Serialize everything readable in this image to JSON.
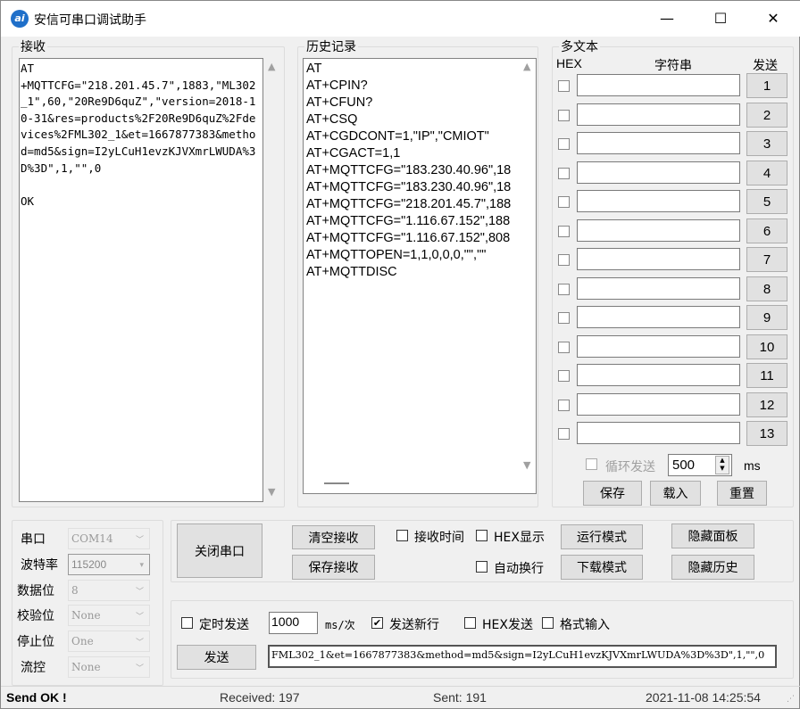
{
  "window": {
    "title": "安信可串口调试助手",
    "icon_text": "ai",
    "minimize": "—",
    "maximize": "☐",
    "close": "✕"
  },
  "receive": {
    "label": "接收",
    "text": "AT\n+MQTTCFG=\"218.201.45.7\",1883,\"ML302_1\",60,\"20Re9D6quZ\",\"version=2018-10-31&res=products%2F20Re9D6quZ%2Fdevices%2FML302_1&et=1667877383&method=md5&sign=I2yLCuH1evzKJVXmrLWUDA%3D%3D\",1,\"\",0\n\nOK"
  },
  "history": {
    "label": "历史记录",
    "items": [
      "AT",
      "AT+CPIN?",
      "AT+CFUN?",
      "AT+CSQ",
      "AT+CGDCONT=1,\"IP\",\"CMIOT\"",
      "AT+CGACT=1,1",
      "AT+MQTTCFG=\"183.230.40.96\",18",
      "AT+MQTTCFG=\"183.230.40.96\",18",
      "AT+MQTTCFG=\"218.201.45.7\",188",
      "AT+MQTTCFG=\"1.116.67.152\",188",
      "AT+MQTTCFG=\"1.116.67.152\",808",
      "AT+MQTTOPEN=1,1,0,0,0,\"\",\"\"",
      "AT+MQTTDISC"
    ]
  },
  "multi": {
    "label": "多文本",
    "hex_header": "HEX",
    "string_header": "字符串",
    "send_header": "发送",
    "rows": [
      "1",
      "2",
      "3",
      "4",
      "5",
      "6",
      "7",
      "8",
      "9",
      "10",
      "11",
      "12",
      "13"
    ],
    "loop_label": "循环发送",
    "interval": "500",
    "unit": "ms",
    "save": "保存",
    "load": "载入",
    "reset": "重置"
  },
  "port": {
    "rows": [
      {
        "label": "串口",
        "value": "COM14"
      },
      {
        "label": "波特率",
        "value": "115200"
      },
      {
        "label": "数据位",
        "value": "8"
      },
      {
        "label": "校验位",
        "value": "None"
      },
      {
        "label": "停止位",
        "value": "One"
      },
      {
        "label": "流控",
        "value": "None"
      }
    ]
  },
  "controls": {
    "close_port": "关闭串口",
    "clear_receive": "清空接收",
    "save_receive": "保存接收",
    "receive_time": "接收时间",
    "hex_display": "HEX显示",
    "run_mode": "运行模式",
    "auto_wrap": "自动换行",
    "download_mode": "下载模式",
    "hide_panel": "隐藏面板",
    "hide_history": "隐藏历史"
  },
  "send": {
    "timed_send": "定时发送",
    "interval": "1000",
    "unit": "ms/次",
    "send_newline": "发送新行",
    "send_newline_checked": true,
    "hex_send": "HEX发送",
    "format_input": "格式输入",
    "send_button": "发送",
    "text": "FML302_1&et=1667877383&method=md5&sign=I2yLCuH1evzKJVXmrLWUDA%3D%3D\",1,\"\",0"
  },
  "statusbar": {
    "message": "Send OK !",
    "received": "Received: 197",
    "sent": "Sent: 191",
    "datetime": "2021-11-08 14:25:54"
  }
}
